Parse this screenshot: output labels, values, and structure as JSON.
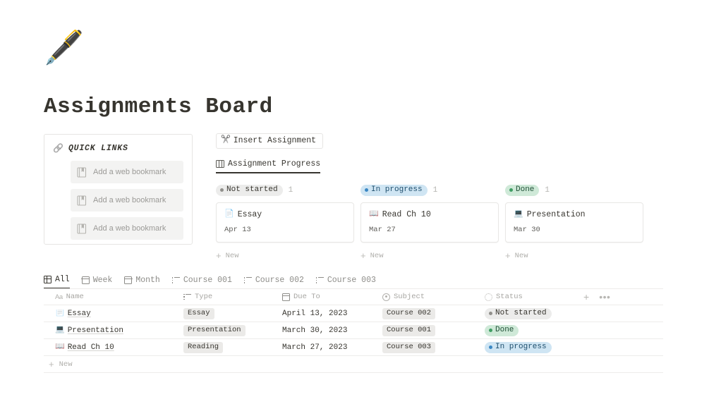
{
  "page": {
    "icon": "🖋️",
    "icon_name": "fountain-pen-emoji",
    "title": "Assignments Board"
  },
  "quick_links": {
    "icon": "🔗",
    "title": "QUICK LINKS",
    "items": [
      {
        "label": "Add a web bookmark"
      },
      {
        "label": "Add a web bookmark"
      },
      {
        "label": "Add a web bookmark"
      }
    ]
  },
  "board": {
    "insert_button": {
      "icon": "✂️",
      "label": "Insert Assignment"
    },
    "tab": {
      "label": "Assignment Progress"
    },
    "new_label": "New",
    "columns": [
      {
        "status": "Not started",
        "count": "1",
        "pill_bg": "#ececeb",
        "pill_text": "#37352f",
        "dot_color": "#908f8b",
        "cards": [
          {
            "emoji": "📄",
            "title": "Essay",
            "date": "Apr 13"
          }
        ]
      },
      {
        "status": "In progress",
        "count": "1",
        "pill_bg": "#cfe5f3",
        "pill_text": "#1f4f6e",
        "dot_color": "#3a87c4",
        "cards": [
          {
            "emoji": "📖",
            "title": "Read Ch 10",
            "date": "Mar 27"
          }
        ]
      },
      {
        "status": "Done",
        "count": "1",
        "pill_bg": "#cfe9d8",
        "pill_text": "#1f5136",
        "dot_color": "#3f9e63",
        "cards": [
          {
            "emoji": "💻",
            "title": "Presentation",
            "date": "Mar 30"
          }
        ]
      }
    ]
  },
  "table": {
    "views": [
      {
        "label": "All",
        "icon": "grid-icon",
        "active": true
      },
      {
        "label": "Week",
        "icon": "calendar-icon",
        "active": false
      },
      {
        "label": "Month",
        "icon": "calendar-icon",
        "active": false
      },
      {
        "label": "Course 001",
        "icon": "list-icon",
        "active": false
      },
      {
        "label": "Course 002",
        "icon": "list-icon",
        "active": false
      },
      {
        "label": "Course 003",
        "icon": "list-icon",
        "active": false
      }
    ],
    "columns": [
      {
        "label": "Name",
        "icon": "text-aa-icon"
      },
      {
        "label": "Type",
        "icon": "list-icon"
      },
      {
        "label": "Due To",
        "icon": "calendar-icon"
      },
      {
        "label": "Subject",
        "icon": "select-circle-icon"
      },
      {
        "label": "Status",
        "icon": "status-spinner-icon"
      }
    ],
    "actions": {
      "add": "+",
      "more": "•••"
    },
    "rows": [
      {
        "emoji": "📄",
        "name": "Essay",
        "type": "Essay",
        "due": "April 13, 2023",
        "subject": "Course 002",
        "status": "Not started",
        "status_bg": "#ececeb",
        "status_text": "#37352f",
        "status_dot": "#908f8b"
      },
      {
        "emoji": "💻",
        "name": "Presentation",
        "type": "Presentation",
        "due": "March 30, 2023",
        "subject": "Course 001",
        "status": "Done",
        "status_bg": "#cfe9d8",
        "status_text": "#1f5136",
        "status_dot": "#3f9e63"
      },
      {
        "emoji": "📖",
        "name": "Read Ch 10",
        "type": "Reading",
        "due": "March 27, 2023",
        "subject": "Course 003",
        "status": "In progress",
        "status_bg": "#cfe5f3",
        "status_text": "#1f4f6e",
        "status_dot": "#3a87c4"
      }
    ],
    "new_label": "New"
  }
}
